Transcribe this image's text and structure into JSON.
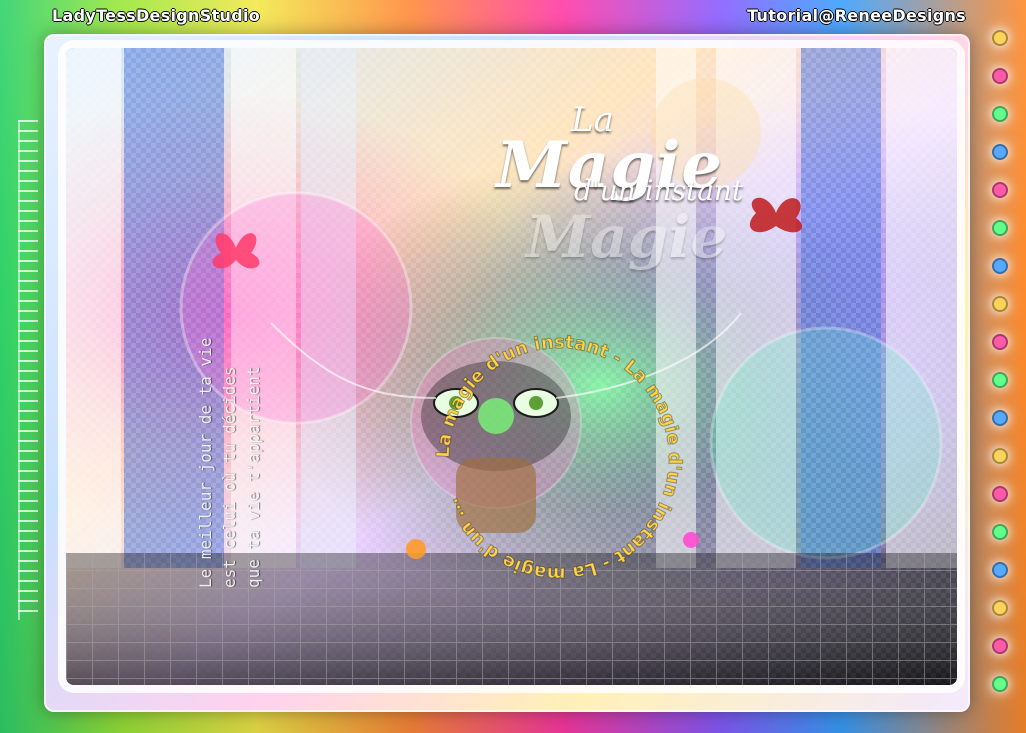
{
  "brand": {
    "left": "LadyTessDesignStudio",
    "right": "Tutorial@ReneeDesigns"
  },
  "poster": {
    "title": {
      "la": "La",
      "magie": "Magie",
      "dun_instant": "d'un instant",
      "shadow": "Magie"
    },
    "vertical_lines": [
      "Le meilleur jour de ta vie",
      "est celui où tu décides",
      "que ta vie t'appartient"
    ],
    "ring_text": "La magie d'un instant - La magie d'un instant - La magie d'un ..."
  },
  "colors": {
    "accent_pink": "#ff3aa6",
    "accent_orange": "#ff8a2a",
    "accent_blue": "#3aa0ff",
    "accent_green": "#2fd16b"
  }
}
